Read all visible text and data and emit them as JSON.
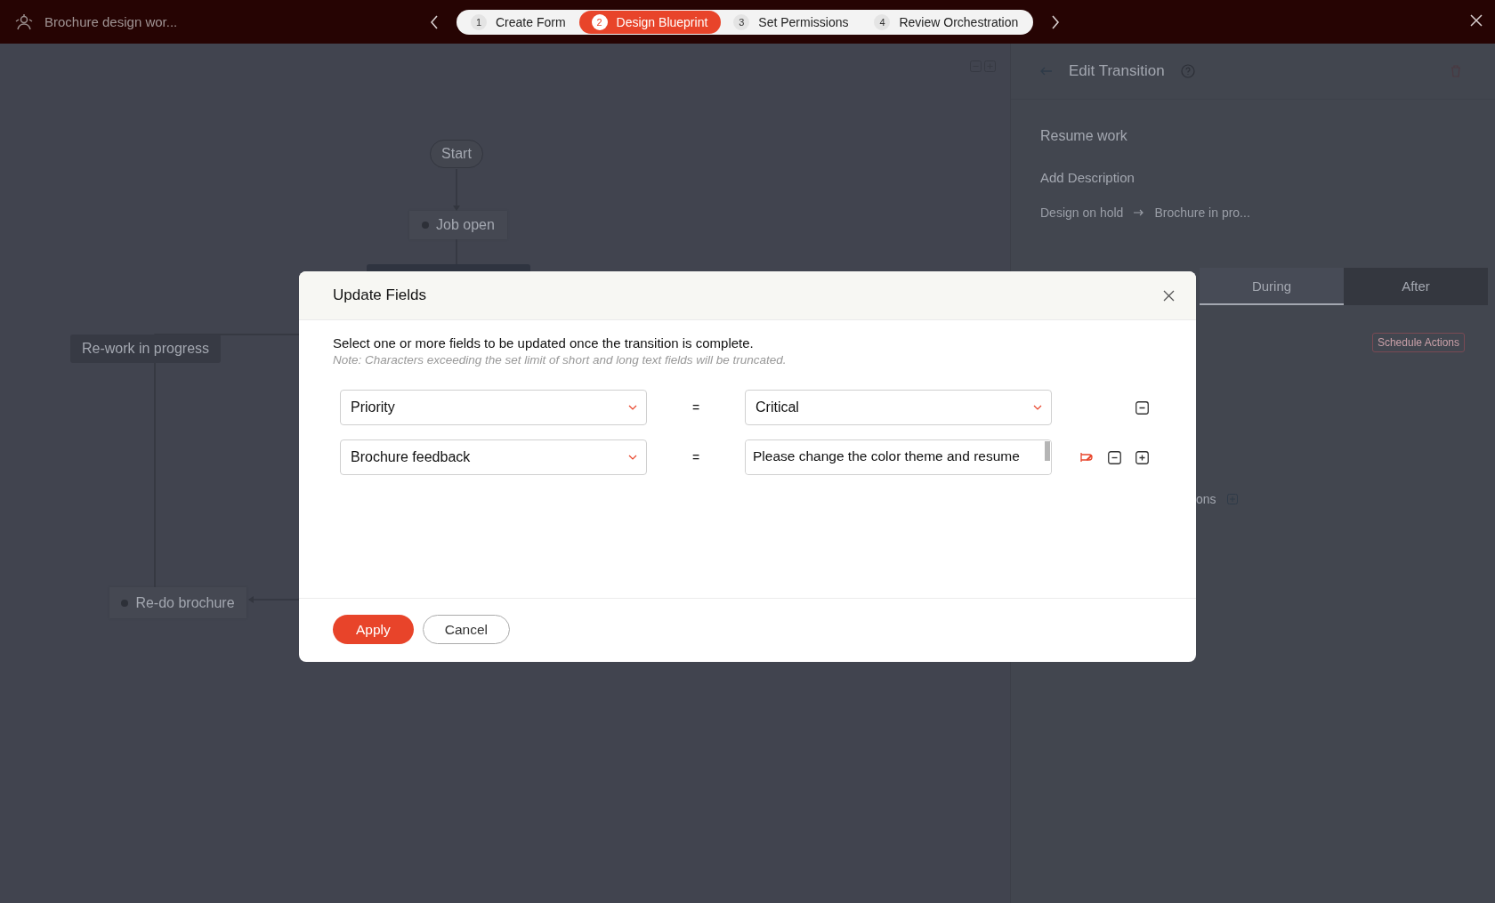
{
  "app_bar": {
    "title": "Brochure design wor...",
    "steps": [
      {
        "number": "1",
        "label": "Create Form",
        "selected": false
      },
      {
        "number": "2",
        "label": "Design Blueprint",
        "selected": true
      },
      {
        "number": "3",
        "label": "Set Permissions",
        "selected": false
      },
      {
        "number": "4",
        "label": "Review Orchestration",
        "selected": false
      }
    ]
  },
  "canvas": {
    "nodes": [
      {
        "kind": "start",
        "label": "Start"
      },
      {
        "kind": "state",
        "label": "Job open"
      },
      {
        "kind": "hidden"
      },
      {
        "kind": "block",
        "label": "Re-work in progress"
      },
      {
        "kind": "state",
        "label": "Re-do brochure"
      }
    ]
  },
  "panel": {
    "title": "Edit Transition",
    "name": "Resume work",
    "description": "Add Description",
    "from": "Design on hold",
    "to": "Brochure in pro...",
    "tabs": [
      {
        "label": "During",
        "selected": true
      },
      {
        "label": "After",
        "selected": false
      }
    ],
    "schedule_button": "Schedule Actions",
    "section_label": "ons"
  },
  "dialog": {
    "title": "Update Fields",
    "intro": "Select one or more fields to be updated once the transition is complete.",
    "note": "Note: Characters exceeding the set limit of short and long text fields will be truncated.",
    "rows": [
      {
        "field": "Priority",
        "operator": "=",
        "kind": "select",
        "value": "Critical",
        "actions": [
          {
            "kind": "remove"
          }
        ]
      },
      {
        "field": "Brochure feedback",
        "operator": "=",
        "kind": "textarea",
        "value": "Please change the color theme and resume",
        "actions": [
          {
            "kind": "link"
          },
          {
            "kind": "remove"
          },
          {
            "kind": "add"
          }
        ]
      }
    ],
    "apply": "Apply",
    "cancel": "Cancel"
  }
}
